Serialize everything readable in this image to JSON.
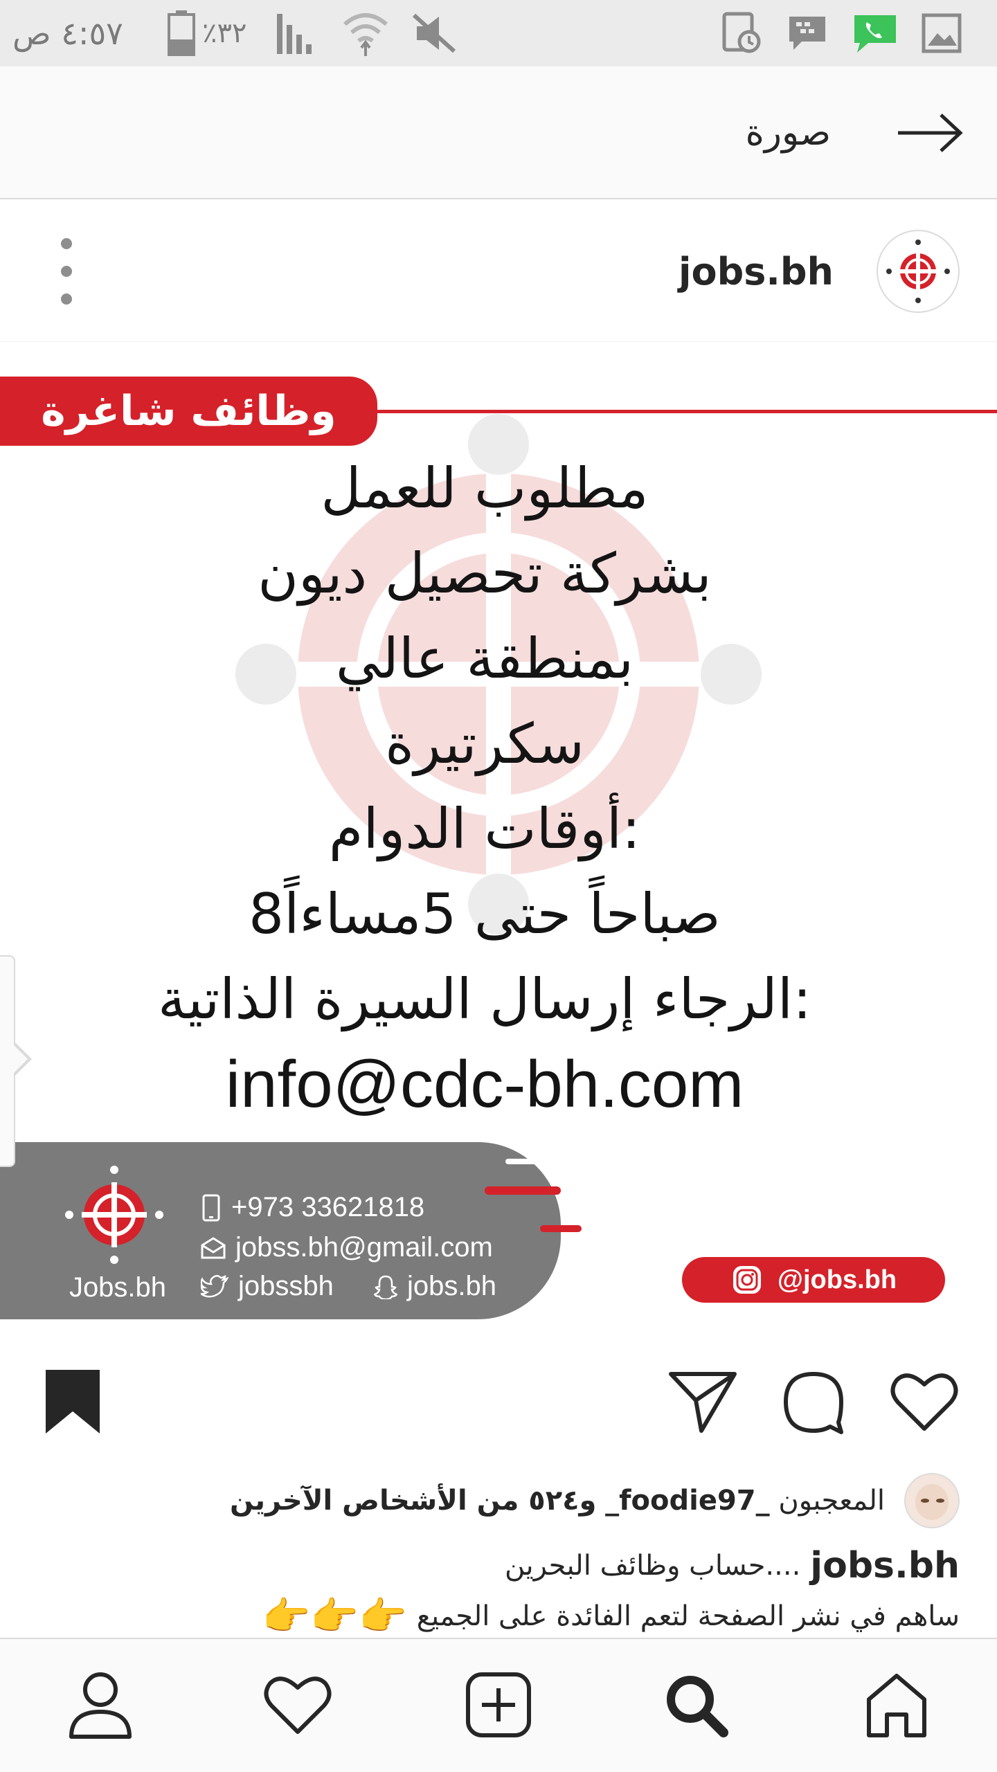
{
  "status_bar": {
    "time": "٤:٥٧ ص",
    "battery": "٪٣٢",
    "icons": [
      "muted-icon",
      "wifi-icon",
      "signal-icon",
      "battery-icon",
      "calendar-icon",
      "bbm-icon",
      "phone-icon",
      "gallery-icon"
    ]
  },
  "top_bar": {
    "title": "صورة",
    "back_icon": "arrow-right-icon"
  },
  "post": {
    "username": "jobs.bh",
    "more_icon": "more-vertical-icon",
    "image": {
      "tag": "وظائف شاغرة",
      "lines": [
        "مطلوب للعمل",
        "بشركة تحصيل ديون",
        "بمنطقة عالي",
        "سكرتيرة",
        "أوقات الدوام:",
        "8صباحاً حتى 5مساءاً",
        "الرجاء إرسال السيرة الذاتية:"
      ],
      "email": "info@cdc-bh.com",
      "footer": {
        "brand": "Jobs.bh",
        "phone": "+973 33621818",
        "email": "jobss.bh@gmail.com",
        "twitter": "jobssbh",
        "snapchat": "jobs.bh"
      },
      "instagram": "@jobs.bh"
    },
    "likes": {
      "prefix": "المعجبون",
      "user": "_foodie97_",
      "rest": "و٥٢٤ من الأشخاص الآخرين"
    },
    "caption": {
      "user": "jobs.bh",
      "text": "....حساب وظائف البحرين",
      "line2": "ساهم في نشر الصفحة لتعم الفائدة على الجميع",
      "emojis": "👉👉👉"
    }
  },
  "colors": {
    "brand_red": "#d52129",
    "card_gray": "#7b7b7b"
  },
  "bottom_nav": [
    "profile-icon",
    "heart-icon",
    "add-icon",
    "search-icon",
    "home-icon"
  ]
}
